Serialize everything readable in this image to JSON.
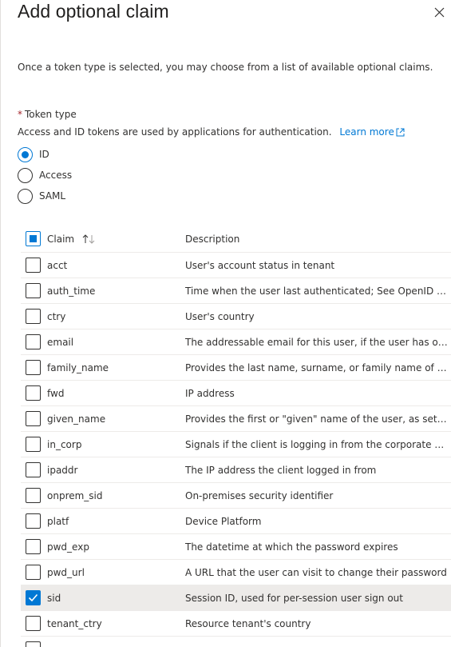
{
  "panel": {
    "title": "Add optional claim",
    "intro": "Once a token type is selected, you may choose from a list of available optional claims.",
    "token_type": {
      "required_mark": "*",
      "label": "Token type",
      "help": "Access and ID tokens are used by applications for authentication.",
      "learn_more": "Learn more",
      "options": [
        {
          "label": "ID",
          "checked": true
        },
        {
          "label": "Access",
          "checked": false
        },
        {
          "label": "SAML",
          "checked": false
        }
      ]
    }
  },
  "table": {
    "columns": {
      "claim": "Claim",
      "description": "Description"
    },
    "select_all": "partial",
    "rows": [
      {
        "claim": "acct",
        "description": "User's account status in tenant",
        "checked": false
      },
      {
        "claim": "auth_time",
        "description": "Time when the user last authenticated; See OpenID Connect spec",
        "checked": false
      },
      {
        "claim": "ctry",
        "description": "User's country",
        "checked": false
      },
      {
        "claim": "email",
        "description": "The addressable email for this user, if the user has one",
        "checked": false
      },
      {
        "claim": "family_name",
        "description": "Provides the last name, surname, or family name of the user",
        "checked": false
      },
      {
        "claim": "fwd",
        "description": "IP address",
        "checked": false
      },
      {
        "claim": "given_name",
        "description": "Provides the first or \"given\" name of the user, as set on the user object",
        "checked": false
      },
      {
        "claim": "in_corp",
        "description": "Signals if the client is logging in from the corporate network",
        "checked": false
      },
      {
        "claim": "ipaddr",
        "description": "The IP address the client logged in from",
        "checked": false
      },
      {
        "claim": "onprem_sid",
        "description": "On-premises security identifier",
        "checked": false
      },
      {
        "claim": "platf",
        "description": "Device Platform",
        "checked": false
      },
      {
        "claim": "pwd_exp",
        "description": "The datetime at which the password expires",
        "checked": false
      },
      {
        "claim": "pwd_url",
        "description": "A URL that the user can visit to change their password",
        "checked": false
      },
      {
        "claim": "sid",
        "description": "Session ID, used for per-session user sign out",
        "checked": true
      },
      {
        "claim": "tenant_ctry",
        "description": "Resource tenant's country",
        "checked": false
      }
    ]
  },
  "colors": {
    "accent": "#0078d4",
    "required": "#a4262c",
    "selected_row": "#edebe9"
  }
}
